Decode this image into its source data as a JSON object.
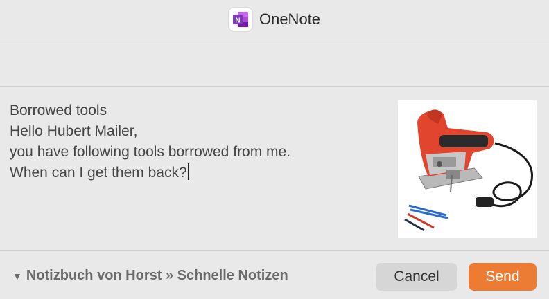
{
  "window": {
    "app_name": "OneNote",
    "app_icon": "onenote-logo-icon",
    "app_icon_letter": "N",
    "brand_color": "#7b3ab8"
  },
  "subject": {
    "value": ""
  },
  "message": {
    "lines": [
      "Borrowed tools",
      "Hello Hubert Mailer,",
      "you have following tools borrowed from me.",
      "When can I get them back?"
    ]
  },
  "attachment": {
    "icon": "jigsaw-image"
  },
  "footer": {
    "expand_icon": "disclosure-triangle-icon",
    "notebook_path": "Notizbuch von Horst » Schnelle Notizen",
    "cancel_label": "Cancel",
    "send_label": "Send",
    "send_color": "#ec7c34"
  }
}
